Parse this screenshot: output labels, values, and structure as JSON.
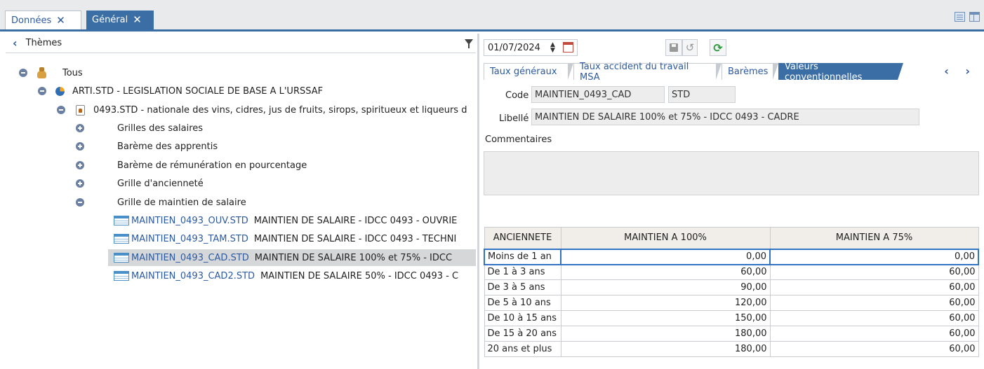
{
  "top_tabs": [
    {
      "label": "Données",
      "close": "✕"
    },
    {
      "label": "Général",
      "close": "✕"
    }
  ],
  "left": {
    "back": "‹",
    "title": "Thèmes",
    "tree": [
      {
        "label": "Tous"
      },
      {
        "label": "ARTI.STD - LEGISLATION SOCIALE DE BASE A L'URSSAF"
      },
      {
        "label": "0493.STD - nationale des vins, cidres, jus de fruits, sirops, spiritueux et liqueurs d"
      },
      {
        "label": "Grilles des salaires"
      },
      {
        "label": "Barème des apprentis"
      },
      {
        "label": "Barème de rémunération en pourcentage"
      },
      {
        "label": "Grille d'ancienneté"
      },
      {
        "label": "Grille de maintien de salaire"
      },
      {
        "code": "MAINTIEN_0493_OUV.STD",
        "desc": "MAINTIEN DE SALAIRE - IDCC 0493 - OUVRIE"
      },
      {
        "code": "MAINTIEN_0493_TAM.STD",
        "desc": "MAINTIEN DE SALAIRE - IDCC 0493 - TECHNI"
      },
      {
        "code": "MAINTIEN_0493_CAD.STD",
        "desc": "MAINTIEN DE SALAIRE 100% et 75% - IDCC"
      },
      {
        "code": "MAINTIEN_0493_CAD2.STD",
        "desc": "MAINTIEN DE SALAIRE 50% - IDCC 0493 - C"
      }
    ]
  },
  "right": {
    "date": "01/07/2024",
    "tabs": [
      "Taux généraux",
      "Taux accident du travail MSA",
      "Barèmes",
      "Valeurs conventionnelles"
    ],
    "nav": "‹ ›",
    "code_label": "Code",
    "code_value": "MAINTIEN_0493_CAD",
    "code_suffix": "STD",
    "libelle_label": "Libellé",
    "libelle_value": "MAINTIEN DE SALAIRE 100% et 75% - IDCC 0493 - CADRE",
    "comment_label": "Commentaires",
    "table": {
      "headers": [
        "ANCIENNETE",
        "MAINTIEN A 100%",
        "MAINTIEN A 75%"
      ],
      "rows": [
        [
          "Moins de 1 an",
          "0,00",
          "0,00"
        ],
        [
          "De 1 à 3 ans",
          "60,00",
          "60,00"
        ],
        [
          "De 3 à 5 ans",
          "90,00",
          "60,00"
        ],
        [
          "De 5 à 10 ans",
          "120,00",
          "60,00"
        ],
        [
          "De 10 à 15 ans",
          "150,00",
          "60,00"
        ],
        [
          "De 15 à 20 ans",
          "180,00",
          "60,00"
        ],
        [
          "20 ans et plus",
          "180,00",
          "60,00"
        ]
      ]
    }
  }
}
